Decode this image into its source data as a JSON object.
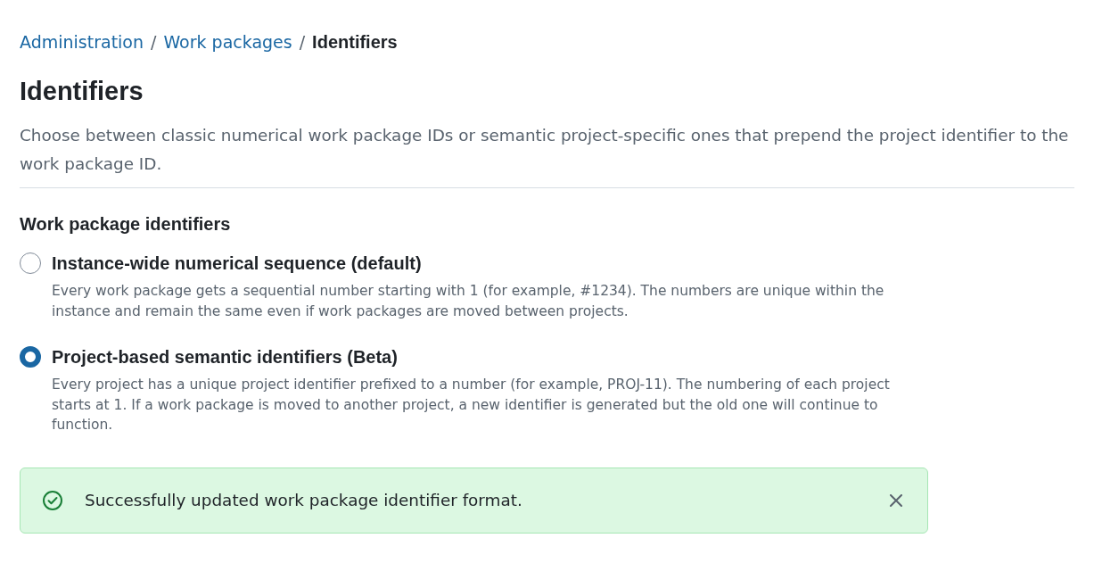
{
  "breadcrumb": [
    {
      "label": "Administration",
      "kind": "link",
      "separator": "/"
    },
    {
      "label": "Work packages",
      "kind": "link",
      "separator": "/"
    },
    {
      "label": "Identifiers",
      "kind": "current"
    }
  ],
  "page": {
    "title": "Identifiers",
    "description": "Choose between classic numerical work package IDs or semantic project-specific ones that prepend the project identifier to the work package ID."
  },
  "section": {
    "heading": "Work package identifiers",
    "options": [
      {
        "label": "Instance-wide numerical sequence (default)",
        "description": "Every work package gets a sequential number starting with 1 (for example, #1234). The numbers are unique within the instance and remain the same even if work packages are moved between projects.",
        "selected": false
      },
      {
        "label": "Project-based semantic identifiers (Beta)",
        "description": "Every project has a unique project identifier prefixed to a number (for example, PROJ-11). The numbering of each project starts at 1. If a work package is moved to another project, a new identifier is generated but the old one will continue to function.",
        "selected": true
      }
    ]
  },
  "flash": {
    "kind": "success",
    "message": "Successfully updated work package identifier format."
  }
}
